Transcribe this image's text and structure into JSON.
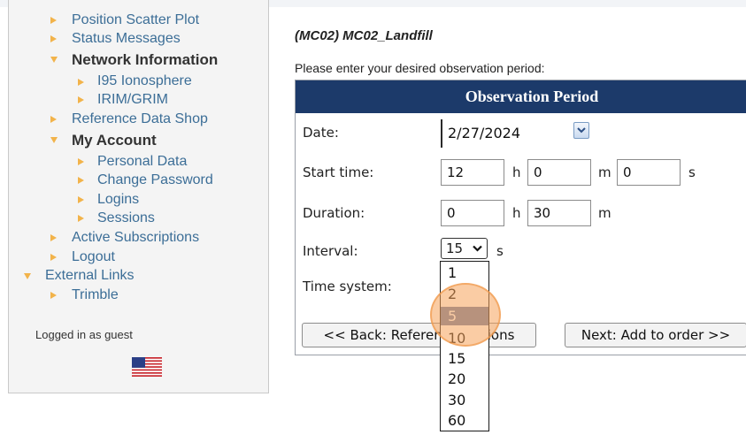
{
  "sidebar": {
    "items": [
      {
        "label": "Position Scatter Plot"
      },
      {
        "label": "Status Messages"
      },
      {
        "label": "Network Information"
      },
      {
        "label": "I95 Ionosphere"
      },
      {
        "label": "IRIM/GRIM"
      },
      {
        "label": "Reference Data Shop"
      },
      {
        "label": "My Account"
      },
      {
        "label": "Personal Data"
      },
      {
        "label": "Change Password"
      },
      {
        "label": "Logins"
      },
      {
        "label": "Sessions"
      },
      {
        "label": "Active Subscriptions"
      },
      {
        "label": "Logout"
      },
      {
        "label": "External Links"
      },
      {
        "label": "Trimble"
      }
    ],
    "logged_in": "Logged in as guest",
    "flag_icon": "us-flag-icon"
  },
  "main": {
    "station_title": "(MC02) MC02_Landfill",
    "prompt": "Please enter your desired observation period:",
    "panel_title": "Observation Period",
    "date": {
      "label": "Date:",
      "value": "2/27/2024"
    },
    "start_time": {
      "label": "Start time:",
      "hours": "12",
      "minutes": "0",
      "seconds": "0",
      "h_unit": "h",
      "m_unit": "m",
      "s_unit": "s"
    },
    "duration": {
      "label": "Duration:",
      "hours": "0",
      "minutes": "30",
      "h_unit": "h",
      "m_unit": "m"
    },
    "interval": {
      "label": "Interval:",
      "selected": "15",
      "unit": "s",
      "options": [
        "1",
        "2",
        "5",
        "10",
        "15",
        "20",
        "30",
        "60"
      ],
      "highlighted": "5"
    },
    "time_system": {
      "label": "Time system:"
    },
    "back_button": "<< Back: Reference stations",
    "next_button": "Next: Add to order >>"
  },
  "colors": {
    "header_bg": "#1c3a6a",
    "link": "#3c6e97",
    "arrow": "#f2b34a",
    "option_highlight": "#6b7fa8",
    "click_indicator": "#f5a35a"
  }
}
